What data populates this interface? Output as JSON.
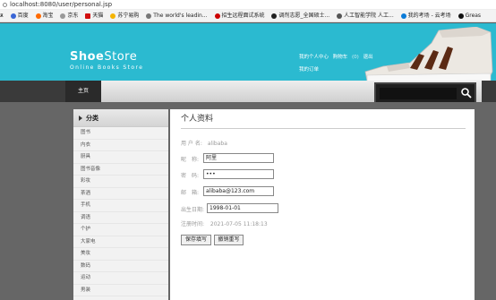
{
  "browser": {
    "url": "localhost:8080/user/personal.jsp",
    "bookmarks": [
      {
        "label": "ѫ",
        "color": "#999"
      },
      {
        "label": "百度",
        "color": "#3a66d6"
      },
      {
        "label": "淘宝",
        "color": "#ff6a00"
      },
      {
        "label": "京东",
        "color": "#333"
      },
      {
        "label": "天猫",
        "color": "#d10f0f"
      },
      {
        "label": "苏宁易购",
        "color": "#f5b400"
      },
      {
        "label": "The world's leadin...",
        "color": "#222"
      },
      {
        "label": "招生远程面试系统",
        "color": "#c00"
      },
      {
        "label": "调剂志愿_全国硕士...",
        "color": "#222"
      },
      {
        "label": "人工智能学院 人工...",
        "color": "#333"
      },
      {
        "label": "我的考场 - 云考场",
        "color": "#0a7bd8"
      },
      {
        "label": "Greas",
        "color": "#111"
      }
    ]
  },
  "header": {
    "logo_bold": "Shoe",
    "logo_light": "Store",
    "tagline": "Online Books Store",
    "links": [
      "我的个人中心",
      "购物车",
      "(0)",
      "退出"
    ],
    "orders_link": "我的订单",
    "bg_color": "#2bbad0"
  },
  "nav": {
    "home": "主页"
  },
  "sidebar": {
    "title": "分类",
    "items": [
      "图书",
      "内衣",
      "厨具",
      "图书音像",
      "彩妆",
      "茶酒",
      "手机",
      "调语",
      "个护",
      "大家电",
      "美妆",
      "数码",
      "运动",
      "男装"
    ]
  },
  "profile": {
    "title": "个人资料",
    "username_label": "用 户 名:",
    "username_value": "alibaba",
    "nickname_label": "昵　称:",
    "nickname_value": "阿里",
    "password_label": "密　码:",
    "password_value": "•••",
    "email_label": "邮　箱:",
    "email_value": "alibaba@123.com",
    "birthday_label": "出生日期:",
    "birthday_value": "1998-01-01",
    "regtime_label": "注册时间:",
    "regtime_value": "2021-07-05 11:18:13",
    "save_button": "保存填写",
    "reset_button": "撤销重写"
  }
}
